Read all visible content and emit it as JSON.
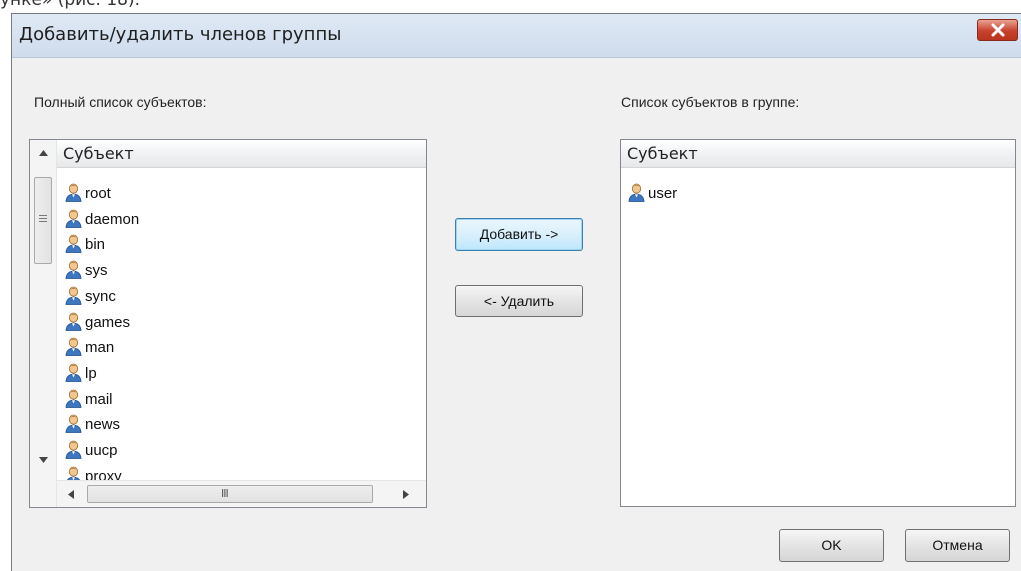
{
  "cropped_top_text": "унке» (рис. 18).",
  "window": {
    "title": "Добавить/удалить членов группы",
    "close_label": "close"
  },
  "left_panel": {
    "label": "Полный список субъектов:",
    "column_header": "Субъект",
    "items": [
      "root",
      "daemon",
      "bin",
      "sys",
      "sync",
      "games",
      "man",
      "lp",
      "mail",
      "news",
      "uucp",
      "proxy"
    ],
    "hscroll_grip": "III"
  },
  "right_panel": {
    "label": "Список субъектов в группе:",
    "column_header": "Субъект",
    "items": [
      "user"
    ]
  },
  "buttons": {
    "add": "Добавить ->",
    "remove": "<- Удалить",
    "ok": "OK",
    "cancel": "Отмена"
  },
  "icons": {
    "row_icon": "user-icon",
    "close": "close-icon"
  }
}
